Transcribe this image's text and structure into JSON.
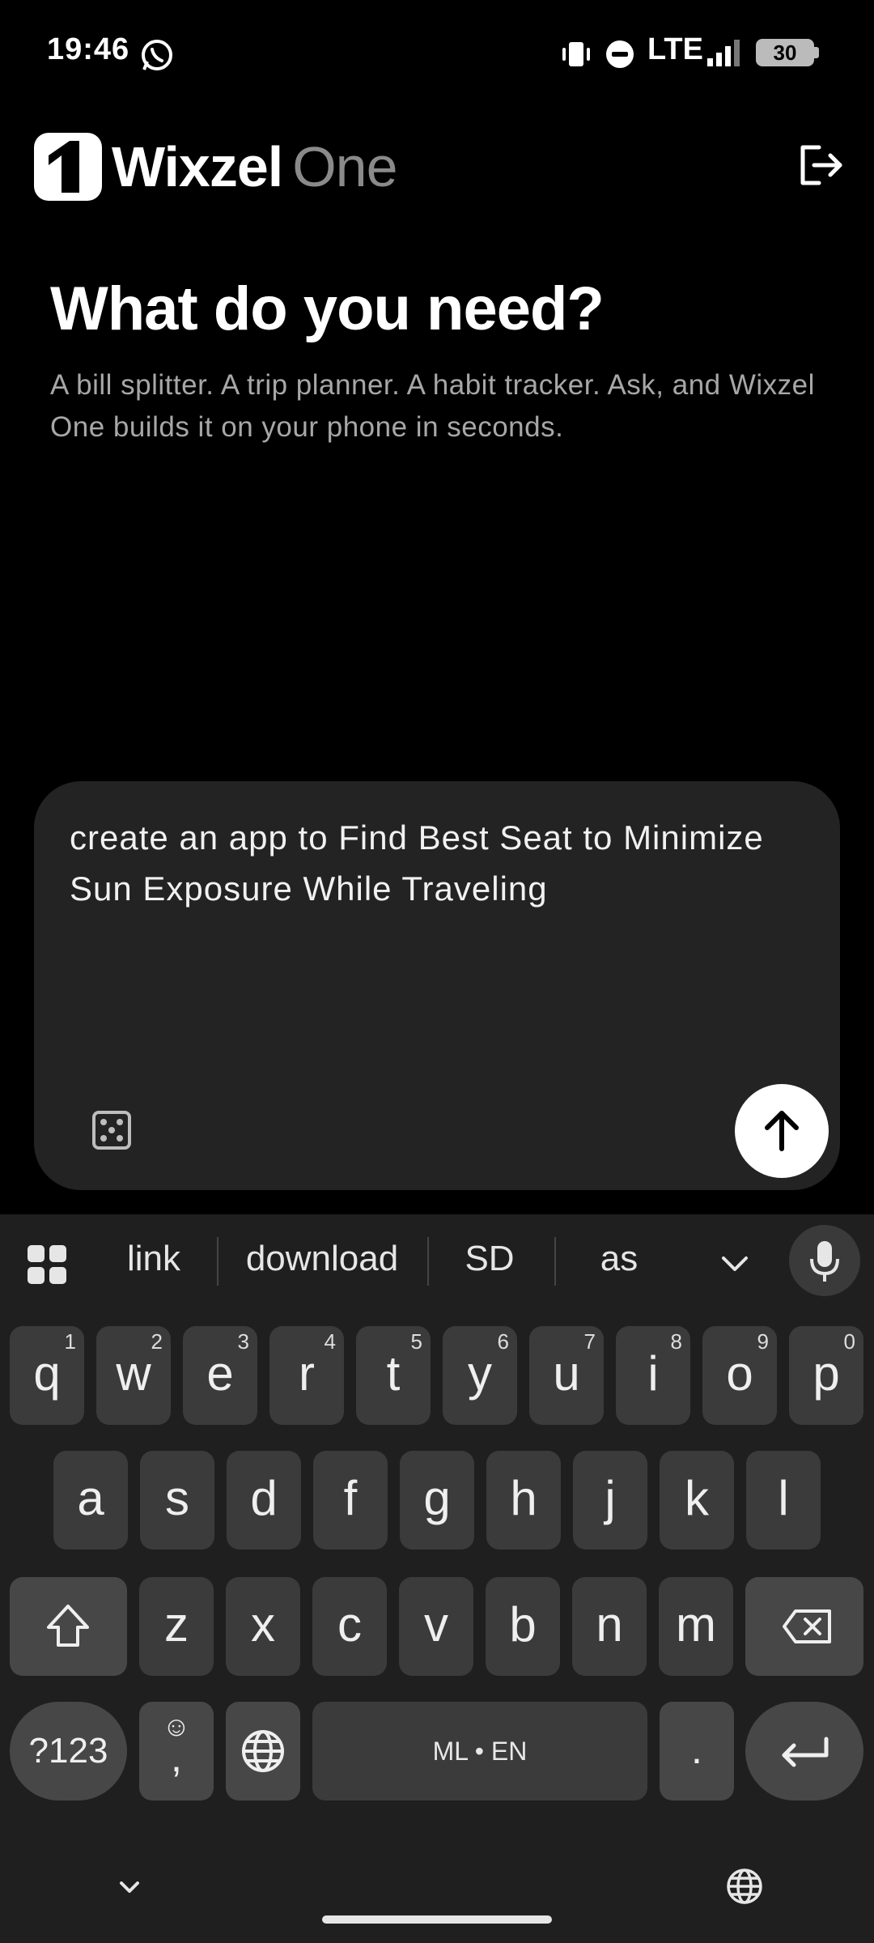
{
  "status": {
    "time": "19:46",
    "network": "LTE",
    "battery": "30"
  },
  "header": {
    "brand": "Wixzel",
    "brand_suffix": "One"
  },
  "hero": {
    "title": "What do you need?",
    "subtitle": "A bill splitter. A trip planner. A habit tracker. Ask, and Wixzel One builds it on your phone in seconds."
  },
  "prompt": {
    "text": "create an app to Find Best Seat to Minimize Sun Exposure While Traveling"
  },
  "keyboard": {
    "suggestions": [
      "link",
      "download",
      "SD",
      "as"
    ],
    "row1": [
      {
        "k": "q",
        "h": "1"
      },
      {
        "k": "w",
        "h": "2"
      },
      {
        "k": "e",
        "h": "3"
      },
      {
        "k": "r",
        "h": "4"
      },
      {
        "k": "t",
        "h": "5"
      },
      {
        "k": "y",
        "h": "6"
      },
      {
        "k": "u",
        "h": "7"
      },
      {
        "k": "i",
        "h": "8"
      },
      {
        "k": "o",
        "h": "9"
      },
      {
        "k": "p",
        "h": "0"
      }
    ],
    "row2": [
      "a",
      "s",
      "d",
      "f",
      "g",
      "h",
      "j",
      "k",
      "l"
    ],
    "row3": [
      "z",
      "x",
      "c",
      "v",
      "b",
      "n",
      "m"
    ],
    "symbols_label": "?123",
    "comma_label": ",",
    "space_label": "ML • EN",
    "period_label": "."
  },
  "icons": {
    "logout": "logout-icon",
    "dice": "dice-icon",
    "send": "arrow-up-icon",
    "mic": "mic-icon",
    "globe": "globe-icon",
    "backspace": "backspace-icon",
    "shift": "shift-icon",
    "enter": "enter-icon"
  }
}
